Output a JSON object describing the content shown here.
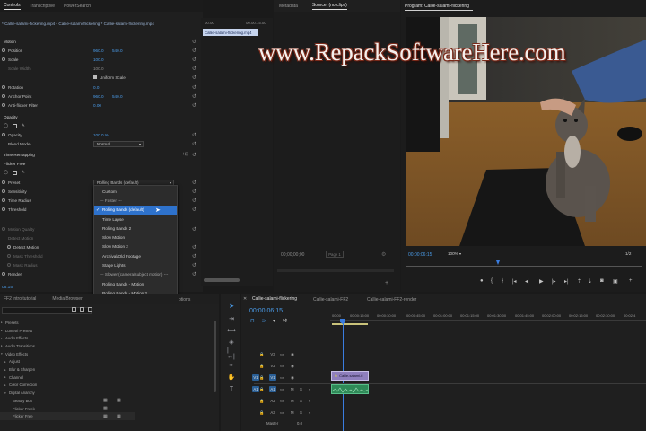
{
  "watermark": "www.RepackSoftwareHere.com",
  "effect_controls": {
    "tabs": [
      "Controls",
      "Transcriptive",
      "PowerSearch"
    ],
    "clip_path": "* Callie-salami-flickering.mp4 • Callie-salami-flickering * Callie-salami-flickering.mp4",
    "mini_timecode_start": "00:00",
    "mini_timecode_end": "00:00:15:00",
    "mini_clip": "Callie-salami-flickering.mp4",
    "rows": [
      {
        "label": "Motion",
        "kind": "sec"
      },
      {
        "label": "Position",
        "v1": "960.0",
        "v2": "540.0"
      },
      {
        "label": "Scale",
        "v1": "100.0"
      },
      {
        "label": "Scale Width",
        "v1": "100.0",
        "dim": true
      },
      {
        "label": "",
        "check": "Uniform Scale"
      },
      {
        "label": "Rotation",
        "v1": "0.0"
      },
      {
        "label": "Anchor Point",
        "v1": "960.0",
        "v2": "540.0"
      },
      {
        "label": "Anti-flicker Filter",
        "v1": "0.00"
      },
      {
        "label": "Opacity",
        "kind": "sec"
      },
      {
        "label": "",
        "shapes": true
      },
      {
        "label": "Opacity",
        "v1": "100.0 %"
      },
      {
        "label": "Blend Mode",
        "dd": "Normal"
      },
      {
        "label": "Time Remapping",
        "kind": "sec"
      },
      {
        "label": "Flicker Free",
        "kind": "sec"
      },
      {
        "label": "",
        "shapes": true
      },
      {
        "label": "Preset",
        "dd": "Rolling Bands (default)"
      },
      {
        "label": "Sensitivity"
      },
      {
        "label": "Time Radius"
      },
      {
        "label": "Threshold"
      },
      {
        "label": "Motion Quality",
        "dim": true
      },
      {
        "label": "Detect Motion",
        "dim": true
      },
      {
        "label": "Detect Motion"
      },
      {
        "label": "Mask Threshold",
        "dim": true
      },
      {
        "label": "Mask Radius",
        "dim": true
      },
      {
        "label": "Render"
      }
    ],
    "bottom_time": "06:15"
  },
  "preset_menu": [
    {
      "label": "Custom"
    },
    {
      "label": "--- Faster ---",
      "sep": true
    },
    {
      "label": "Rolling Bands (default)",
      "checked": true,
      "highlight": true
    },
    {
      "label": "Time Lapse"
    },
    {
      "label": "Rolling Bands 2"
    },
    {
      "label": "Slow Motion"
    },
    {
      "label": "Slow Motion 2"
    },
    {
      "label": "Archival/Old Footage"
    },
    {
      "label": "Stage Lights"
    },
    {
      "label": "--- Slower (camera/subject motion) ---",
      "sep": true
    },
    {
      "label": "Rolling Bands - Motion"
    },
    {
      "label": "Rolling Bands - Motion 2"
    },
    {
      "label": "Extreme Motion"
    },
    {
      "label": "Extreme Motion - Slow"
    },
    {
      "label": "Projection Screen"
    },
    {
      "label": "Slow Motion"
    }
  ],
  "source_monitor": {
    "tabs": [
      "Metadata",
      "Source: (no clips)"
    ],
    "timecode": "00;00;00;00",
    "page": "Page 1"
  },
  "program_monitor": {
    "title": "Program: Callie-salami-flickering",
    "timecode": "00:00:06:15",
    "zoom": "100%",
    "fraction": "1/2"
  },
  "effects_panel": {
    "tabs": [
      "FF2 intro tutorial",
      "Media Browser",
      "ptions"
    ],
    "items": [
      {
        "label": "Presets"
      },
      {
        "label": "Lumetri Presets"
      },
      {
        "label": "Audio Effects"
      },
      {
        "label": "Audio Transitions"
      },
      {
        "label": "Video Effects",
        "open": true
      },
      {
        "label": "Adjust",
        "indent": true
      },
      {
        "label": "Blur & Sharpen",
        "indent": true
      },
      {
        "label": "Channel",
        "indent": true
      },
      {
        "label": "Color Correction",
        "indent": true
      },
      {
        "label": "Digital Anarchy",
        "indent": true,
        "open": true
      },
      {
        "label": "Beauty Box",
        "indent2": true
      },
      {
        "label": "Flicker Freek",
        "indent2": true
      },
      {
        "label": "Flicker Free",
        "indent2": true
      }
    ]
  },
  "timeline": {
    "tabs": [
      "Callie-salami-flickering",
      "Callie-salami-FF2",
      "Callie-salami-FF2-render"
    ],
    "timecode": "00:00:06:15",
    "ruler": [
      "00:00",
      "00:00:15:00",
      "00:00:30:00",
      "00:00:45:00",
      "00:01:00:00",
      "00:01:15:00",
      "00:01:30:00",
      "00:01:45:00",
      "00:02:00:00",
      "00:02:15:00",
      "00:02:30:00",
      "00:02:4"
    ],
    "video_tracks": [
      "V3",
      "V2",
      "V1"
    ],
    "audio_tracks": [
      "A1",
      "A2",
      "A3"
    ],
    "master_label": "Master",
    "master_value": "0.0",
    "clip_label": "Callie-salami-fl"
  },
  "colors": {
    "accent": "#4a9be8",
    "highlight": "#2e72cc",
    "clip_video": "#8f7fbd",
    "clip_audio": "#2f8a58",
    "track_on": "#2a5f96",
    "timeline_timecode": "#4a9be8"
  }
}
